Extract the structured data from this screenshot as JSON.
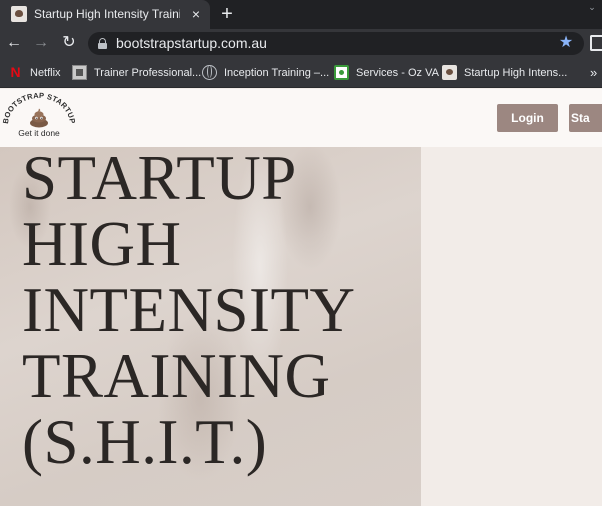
{
  "browser": {
    "tab": {
      "title": "Startup High Intensity Training - ",
      "favicon": "bootstrap-startup-favicon"
    },
    "new_tab_label": "+",
    "tab_close_label": "×",
    "url": "bootstrapstartup.com.au",
    "bookmarks": [
      {
        "label": "Netflix",
        "icon": "netflix-icon"
      },
      {
        "label": "Trainer Professional...",
        "icon": "trainer-icon"
      },
      {
        "label": "Inception Training –...",
        "icon": "globe-icon"
      },
      {
        "label": "Services - Oz VA",
        "icon": "oz-va-icon"
      },
      {
        "label": "Startup High Intens...",
        "icon": "bootstrap-startup-icon"
      }
    ],
    "bookmarks_overflow": "»"
  },
  "site": {
    "logo": {
      "text": "BOOTSTRAP STARTUP",
      "tagline": "Get it done"
    },
    "buttons": {
      "login": "Login",
      "start": "Sta"
    }
  },
  "hero": {
    "title_lines": [
      "STARTUP",
      "HIGH",
      "INTENSITY",
      "TRAINING",
      "(S.H.I.T.)"
    ]
  },
  "colors": {
    "button": "#9c8781",
    "hero_text": "#2b2725",
    "page_bg": "#f2ece8",
    "chrome_dark": "#202124",
    "chrome_toolbar": "#35363a"
  }
}
